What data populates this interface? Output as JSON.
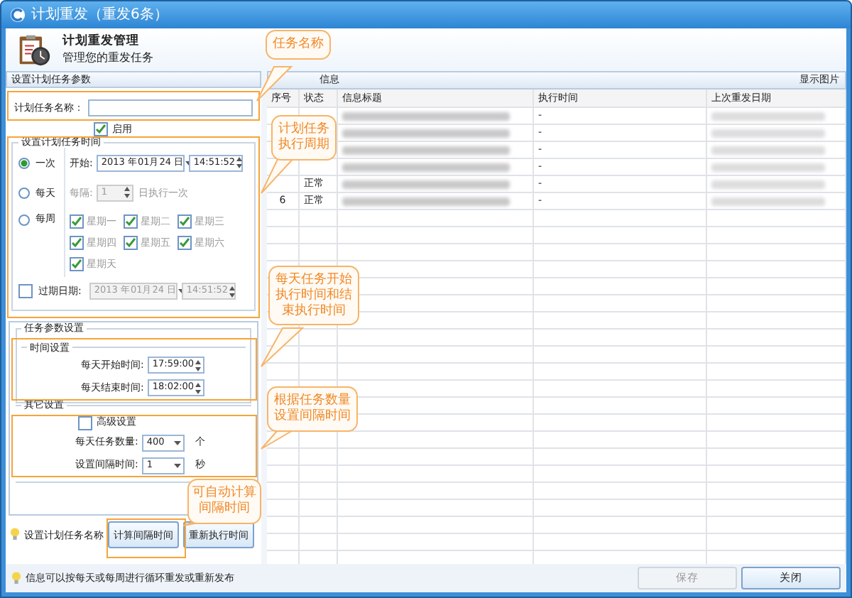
{
  "window": {
    "title": "计划重发（重发6条）"
  },
  "header": {
    "title": "计划重发管理",
    "subtitle": "管理您的重发任务"
  },
  "left_panel": {
    "title": "设置计划任务参数",
    "task_name": {
      "label": "计划任务名称："
    },
    "enabled": {
      "label": "启用",
      "checked": true
    },
    "schedule": {
      "title": "设置计划任务时间",
      "modes": [
        {
          "label": "一次",
          "selected": true
        },
        {
          "label": "每天",
          "selected": false
        },
        {
          "label": "每周",
          "selected": false
        }
      ],
      "start_label": "开始:",
      "start_date": "2013 年01月24 日",
      "start_time": "14:51:52",
      "interval_label": "每隔:",
      "interval_value": "1",
      "interval_suffix": "日执行一次",
      "weekdays": [
        {
          "label": "星期一",
          "checked": true
        },
        {
          "label": "星期二",
          "checked": true
        },
        {
          "label": "星期三",
          "checked": true
        },
        {
          "label": "星期四",
          "checked": true
        },
        {
          "label": "星期五",
          "checked": true
        },
        {
          "label": "星期六",
          "checked": true
        },
        {
          "label": "星期天",
          "checked": true
        }
      ],
      "expiry": {
        "label": "过期日期:",
        "checked": false,
        "date": "2013 年01月24 日",
        "time": "14:51:52"
      }
    },
    "task_params": {
      "title": "任务参数设置",
      "time_group": {
        "title": "时间设置",
        "start_label": "每天开始时间:",
        "start": "17:59:00",
        "end_label": "每天结束时间:",
        "end": "18:02:00"
      }
    },
    "other": {
      "title": "其它设置",
      "advanced": {
        "label": "高级设置",
        "checked": false
      },
      "count_label": "每天任务数量:",
      "count": "400",
      "count_unit": "个",
      "interval_label": "设置间隔时间:",
      "interval": "1",
      "interval_unit": "秒"
    },
    "hint": "设置计划任务名称",
    "buttons": [
      {
        "label": "计算间隔时间"
      },
      {
        "label": "重新执行时间"
      }
    ]
  },
  "right_panel": {
    "title": "信息",
    "show_images": "显示图片",
    "columns": [
      "序号",
      "状态",
      "信息标题",
      "执行时间",
      "上次重发日期"
    ],
    "rows": [
      {
        "exec": "-"
      },
      {
        "exec": "-"
      },
      {
        "exec": "-"
      },
      {
        "exec": "-"
      },
      {
        "status": "正常",
        "exec": "-"
      },
      {
        "seq": "6",
        "status": "正常",
        "exec": "-"
      }
    ]
  },
  "status_bar": {
    "text": "信息可以按每天或每周进行循环重发或重新发布"
  },
  "footer_buttons": [
    {
      "label": "保存",
      "disabled": true
    },
    {
      "label": "关闭",
      "disabled": false
    }
  ],
  "callouts": [
    "任务名称",
    "计划任务执行周期",
    "每天任务开始执行时间和结束执行时间",
    "根据任务数量设置间隔时间",
    "可自动计算间隔时间"
  ]
}
